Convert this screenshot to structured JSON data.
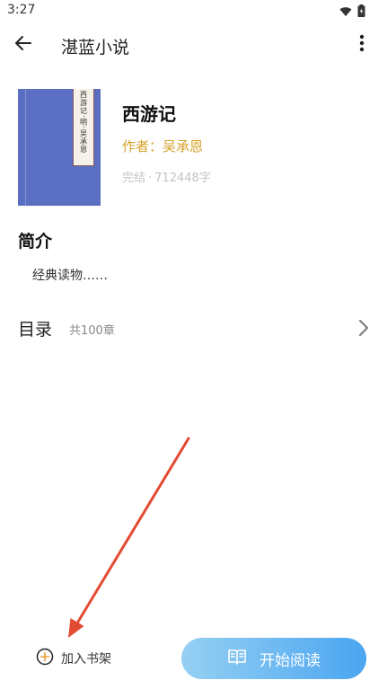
{
  "status_bar": {
    "time": "3:27"
  },
  "app_bar": {
    "title": "湛蓝小说"
  },
  "book": {
    "cover_text": "西游记·明·吴承恩",
    "title": "西游记",
    "author": "作者：吴承恩",
    "status": "完结",
    "separator": "·",
    "word_count": "712448字"
  },
  "intro": {
    "heading": "简介",
    "text": "经典读物……"
  },
  "toc": {
    "label": "目录",
    "count": "共100章"
  },
  "actions": {
    "add_to_shelf": "加入书架",
    "start_reading": "开始阅读"
  },
  "colors": {
    "author": "#d6a12a",
    "cover": "#5b6fc2",
    "read_button_start": "#96d0f3",
    "read_button_end": "#4aa5f0",
    "annotation_arrow": "#e34a33"
  }
}
